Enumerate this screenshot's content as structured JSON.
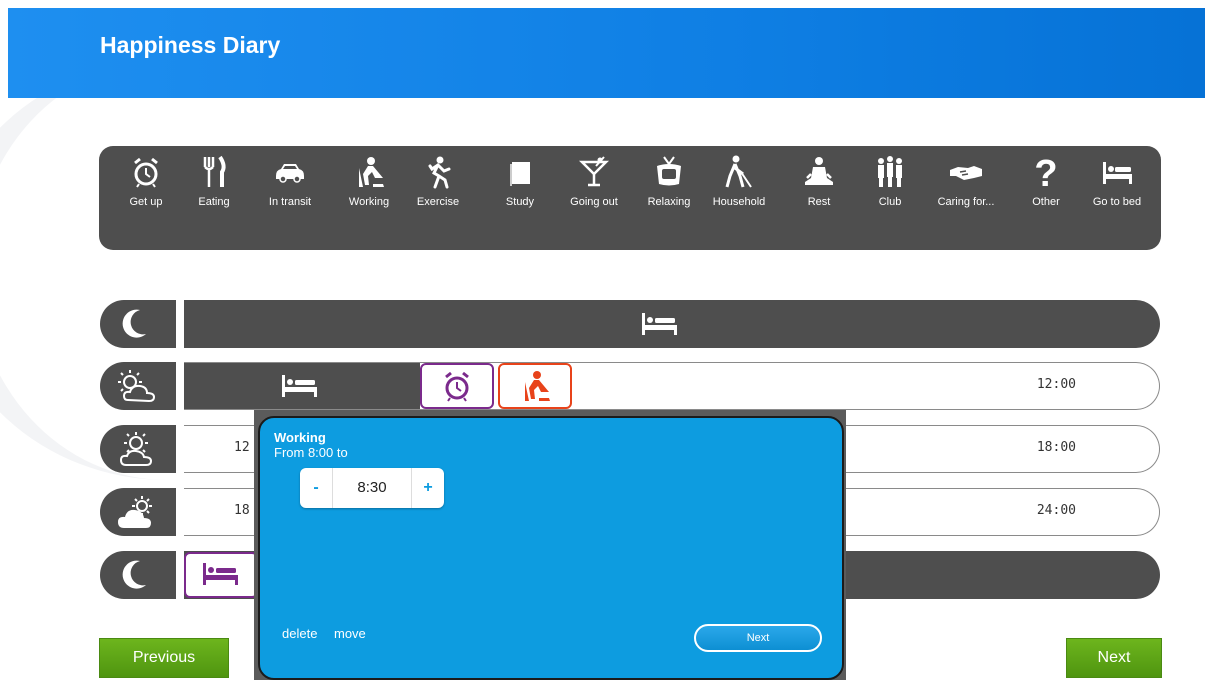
{
  "header": {
    "title": "Happiness Diary"
  },
  "toolbar": {
    "items": [
      {
        "label": "Get up",
        "icon": "alarm-clock-icon"
      },
      {
        "label": "Eating",
        "icon": "fork-knife-icon"
      },
      {
        "label": "In transit",
        "icon": "car-icon"
      },
      {
        "label": "Working",
        "icon": "worker-icon"
      },
      {
        "label": "Exercise",
        "icon": "running-icon"
      },
      {
        "label": "Study",
        "icon": "book-icon"
      },
      {
        "label": "Going out",
        "icon": "cocktail-icon"
      },
      {
        "label": "Relaxing",
        "icon": "tv-icon"
      },
      {
        "label": "Household",
        "icon": "vacuum-icon"
      },
      {
        "label": "Rest",
        "icon": "meditation-icon"
      },
      {
        "label": "Club",
        "icon": "group-icon"
      },
      {
        "label": "Caring for...",
        "icon": "handshake-icon"
      },
      {
        "label": "Other",
        "icon": "question-icon"
      },
      {
        "label": "Go to bed",
        "icon": "bed-icon"
      }
    ]
  },
  "timeline": {
    "rows": [
      {
        "period": "night",
        "icon": "moon-icon",
        "start": "",
        "end": ""
      },
      {
        "period": "morning",
        "icon": "sun-cloud-outline-icon",
        "start": "",
        "end": "12:00"
      },
      {
        "period": "afternoon",
        "icon": "sun-cloud-outline-icon",
        "start": "12",
        "end": "18:00"
      },
      {
        "period": "evening",
        "icon": "sun-cloud-filled-icon",
        "start": "18",
        "end": "24:00"
      },
      {
        "period": "late-night",
        "icon": "moon-icon",
        "start": "",
        "end": ""
      }
    ]
  },
  "dialog": {
    "activity": "Working",
    "from_text": "From 8:00 to",
    "stepper": {
      "minus": "-",
      "value": "8:30",
      "plus": "+"
    },
    "delete_label": "delete",
    "move_label": "move",
    "next_label": "Next"
  },
  "nav": {
    "previous_label": "Previous",
    "next_label": "Next"
  },
  "colors": {
    "header": "#0f7fe4",
    "dialog": "#0d9ce0",
    "toolbar": "#4e4e4e",
    "green": "#5ea516",
    "purple": "#7b2a8c",
    "orange": "#e8431a"
  }
}
